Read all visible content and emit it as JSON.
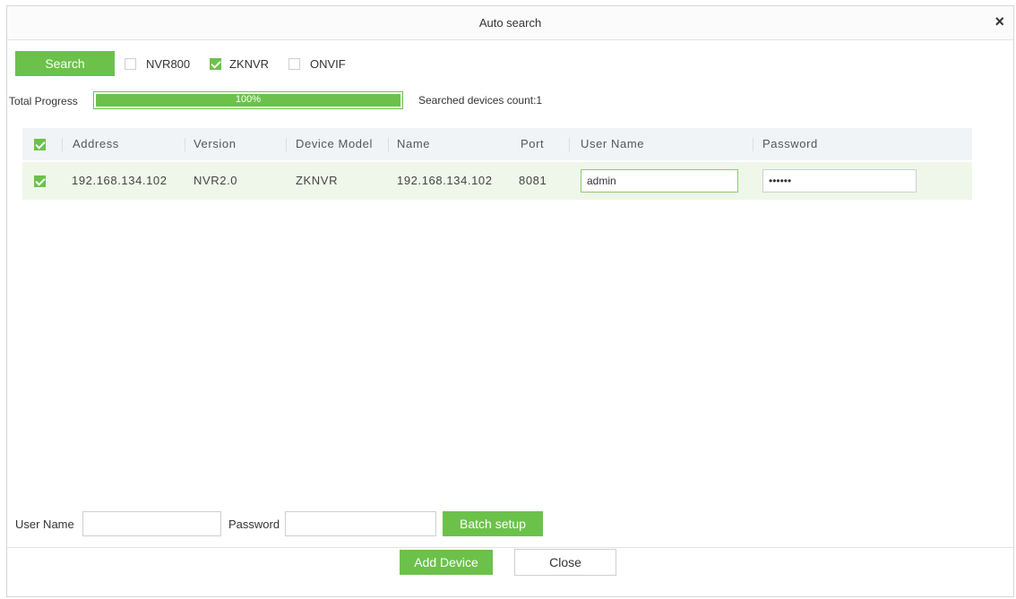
{
  "dialog": {
    "title": "Auto search",
    "close_glyph": "×"
  },
  "toolbar": {
    "search_label": "Search",
    "filters": [
      {
        "label": "NVR800",
        "checked": false
      },
      {
        "label": "ZKNVR",
        "checked": true
      },
      {
        "label": "ONVIF",
        "checked": false
      }
    ]
  },
  "progress": {
    "label": "Total Progress",
    "percent_text": "100%",
    "value": 1.0,
    "count_text": "Searched devices count:1"
  },
  "table": {
    "headers": [
      "Address",
      "Version",
      "Device Model",
      "Name",
      "Port",
      "User Name",
      "Password"
    ],
    "rows": [
      {
        "checked": true,
        "address": "192.168.134.102",
        "version": "NVR2.0",
        "model": "ZKNVR",
        "name": "192.168.134.102",
        "port": "8081",
        "username": "admin",
        "password": "••••••"
      }
    ]
  },
  "batch": {
    "username_label": "User Name",
    "username_value": "",
    "password_label": "Password",
    "password_value": "",
    "setup_label": "Batch setup"
  },
  "footer": {
    "add_label": "Add Device",
    "close_label": "Close"
  },
  "colors": {
    "accent": "#6cc14b",
    "row_highlight": "#eef7e9",
    "header_bg": "#f0f4f7"
  }
}
